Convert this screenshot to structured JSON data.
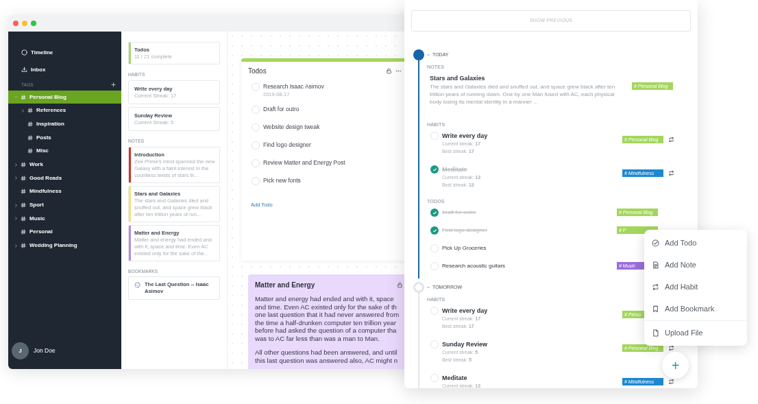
{
  "sidebar": {
    "nav": [
      {
        "kind": "timeline",
        "label": "Timeline"
      },
      {
        "kind": "inbox",
        "label": "Inbox"
      }
    ],
    "tags_heading": "TAGS",
    "tags": [
      {
        "label": "Personal Blog",
        "kind": "folder",
        "expanded": true,
        "selected": true,
        "children": [
          {
            "label": "References",
            "kind": "folder",
            "expanded": false,
            "selected": false
          },
          {
            "label": "Inspiration",
            "kind": "tag",
            "selected": false
          },
          {
            "label": "Posts",
            "kind": "tag",
            "selected": false
          },
          {
            "label": "Misc",
            "kind": "tag",
            "selected": false
          }
        ]
      },
      {
        "label": "Work",
        "kind": "folder",
        "expanded": false,
        "selected": false
      },
      {
        "label": "Good Reads",
        "kind": "folder",
        "expanded": false,
        "selected": false
      },
      {
        "label": "Mindfulness",
        "kind": "tag",
        "selected": false
      },
      {
        "label": "Sport",
        "kind": "folder",
        "expanded": false,
        "selected": false
      },
      {
        "label": "Music",
        "kind": "folder",
        "expanded": false,
        "selected": false
      },
      {
        "label": "Personal",
        "kind": "tag",
        "selected": false
      },
      {
        "label": "Wedding Planning",
        "kind": "folder",
        "expanded": false,
        "selected": false
      }
    ],
    "user": {
      "initial": "J",
      "name": "Jon Doe"
    }
  },
  "overview": {
    "todos": {
      "title": "Todos",
      "subtitle": "11 / 21 complete",
      "color": "#a8d86a"
    },
    "habits_heading": "HABITS",
    "habits": [
      {
        "title": "Write every day",
        "subtitle": "Current Streak: 17"
      },
      {
        "title": "Sunday Review",
        "subtitle": "Current Streak: 5"
      }
    ],
    "notes_heading": "NOTES",
    "notes": [
      {
        "title": "Introduction",
        "excerpt": "Zee Prime's mind spanned the new Galaxy with a faint interest in the countless twists of stars th...",
        "color": "#d0312d"
      },
      {
        "title": "Stars and Galaxies",
        "excerpt": "The stars and Galaxies died and snuffed out, and space grew black after ten trillion years of run...",
        "color": "#f3e27c"
      },
      {
        "title": "Matter and Energy",
        "excerpt": "Matter and energy had ended and with it, space and time. Even AC existed only for the sake of the...",
        "color": "#b58be0"
      }
    ],
    "bookmarks_heading": "BOOKMARKS",
    "bookmarks": [
      {
        "title": "The Last Question -- Isaac Asimov"
      }
    ]
  },
  "todo_board": {
    "title": "Todos",
    "color": "#a3d65c",
    "items": [
      {
        "label": "Research Isaac Asimov",
        "date": "2019-08-17",
        "checked": false
      },
      {
        "label": "Draft for outro",
        "checked": false
      },
      {
        "label": "Website design tweak",
        "checked": false
      },
      {
        "label": "Find logo designer",
        "checked": false
      },
      {
        "label": "Review Matter and Energy Post",
        "checked": false
      },
      {
        "label": "Pick new fonts",
        "checked": false
      }
    ],
    "add_label": "Add Todo"
  },
  "note_board": {
    "title": "Matter and Energy",
    "color": "#e9d9fc",
    "paragraphs": [
      [
        "Matter and energy had ended and with it, space",
        "and time. Even AC existed only for the sake of th",
        "one last question that it had never answered from",
        "the time a half-drunken computer ten trillion year",
        "before had asked the question of a computer tha",
        "was to AC far less than was a man to Man."
      ],
      [
        "All other questions had been answered, and until",
        "this last question was answered also, AC might n"
      ]
    ]
  },
  "timeline": {
    "show_previous": "SHOW PREVIOUS",
    "days": [
      {
        "label": "TODAY",
        "current": true,
        "sections": [
          {
            "heading": "NOTES",
            "items": [
              {
                "kind": "note",
                "title": "Stars and Galaxies",
                "excerpt": "The stars and Galaxies died and snuffed out, and space grew black after ten trillion years of running down. One by one Man fused with AC, each physical body losing its mental identity in a manner ...",
                "tag": {
                  "label": "# Personal Blog",
                  "color": "#a3d65c"
                },
                "repeats": false
              }
            ]
          },
          {
            "heading": "HABITS",
            "items": [
              {
                "kind": "habit",
                "title": "Write every day",
                "checked": false,
                "current": "Current streak: **17**",
                "best": "Best streak: **17**",
                "tag": {
                  "label": "# Personal Blog",
                  "color": "#a3d65c"
                },
                "repeats": true
              },
              {
                "kind": "habit",
                "title": "Meditate",
                "checked": true,
                "current": "Current streak: **13**",
                "best": "Best streak: **13**",
                "tag": {
                  "label": "# Mindfulness",
                  "color": "#1e88d0"
                },
                "repeats": true
              }
            ]
          },
          {
            "heading": "TODOS",
            "items": [
              {
                "kind": "todo",
                "title": "Draft for outro",
                "checked": true,
                "tag": {
                  "label": "# Personal Blog",
                  "color": "#a3d65c"
                },
                "repeats": false
              },
              {
                "kind": "todo",
                "title": "Find logo designer",
                "checked": true,
                "tag": {
                  "label": "# P",
                  "color": "#a3d65c"
                },
                "repeats": false
              },
              {
                "kind": "todo",
                "title": "Pick Up Groceries",
                "checked": false,
                "repeats": false
              },
              {
                "kind": "todo",
                "title": "Research acoustic guitars",
                "checked": false,
                "tag": {
                  "label": "# Music",
                  "color": "#9b6ddb"
                },
                "repeats": false
              }
            ]
          }
        ]
      },
      {
        "label": "TOMORROW",
        "current": false,
        "sections": [
          {
            "heading": "HABITS",
            "items": [
              {
                "kind": "habit",
                "title": "Write every day",
                "checked": false,
                "current": "Current streak: **17**",
                "best": "Best streak: **17**",
                "tag": {
                  "label": "# Perso",
                  "color": "#a3d65c"
                },
                "repeats": false
              },
              {
                "kind": "habit",
                "title": "Sunday Review",
                "checked": false,
                "current": "Current streak: **5**",
                "best": "Best streak: **5**",
                "tag": {
                  "label": "# Personal Blog",
                  "color": "#a3d65c"
                },
                "repeats": true
              },
              {
                "kind": "habit",
                "title": "Meditate",
                "checked": false,
                "current": "Current streak: **13**",
                "tag": {
                  "label": "# Mindfulness",
                  "color": "#1e88d0"
                },
                "repeats": true
              }
            ]
          }
        ]
      }
    ]
  },
  "add_menu": [
    {
      "kind": "todo",
      "label": "Add Todo"
    },
    {
      "kind": "note",
      "label": "Add Note"
    },
    {
      "kind": "habit",
      "label": "Add Habit"
    },
    {
      "kind": "bookmark",
      "label": "Add Bookmark"
    },
    {
      "kind": "file",
      "label": "Upload File"
    }
  ],
  "fab": "+"
}
